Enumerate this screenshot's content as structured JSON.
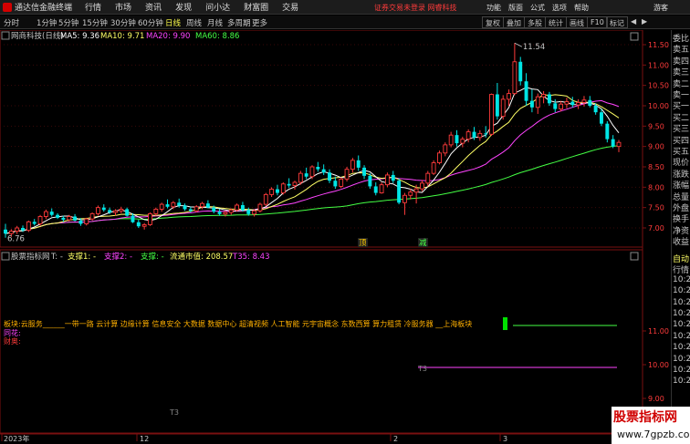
{
  "menubar": {
    "app_title": "通达信金融终端",
    "menus": [
      "行情",
      "市场",
      "资讯",
      "发现",
      "问小达",
      "财富圈",
      "交易"
    ],
    "status": "证券交易未登录  网睿科技",
    "right_menus": [
      "功能",
      "版面",
      "公式",
      "选项",
      "帮助",
      "游客"
    ]
  },
  "periodbar": {
    "periods": [
      "分时",
      "1分钟",
      "5分钟",
      "15分钟",
      "30分钟",
      "60分钟",
      "日线",
      "周线",
      "月线",
      "多周期",
      "更多"
    ],
    "active": "日线",
    "right_buttons": [
      "复权",
      "叠加",
      "多股",
      "统计",
      "画线",
      "F10",
      "标记"
    ]
  },
  "main_chart": {
    "stock_name": "网商科技(日线)",
    "ma_legend": [
      {
        "label": "MA5: 9.36",
        "color": "#ffffff"
      },
      {
        "label": "MA10: 9.71",
        "color": "#ffff66"
      },
      {
        "label": "MA20: 9.90",
        "color": "#ff44ff"
      },
      {
        "label": "MA60: 8.86",
        "color": "#44ff44"
      }
    ],
    "high_label": "11.54",
    "low_label": "6.76",
    "markers": [
      {
        "text": "顶",
        "color": "#ffcc00"
      },
      {
        "text": "减",
        "color": "#44ff44"
      }
    ]
  },
  "indicator_panel": {
    "title": "股票指标网",
    "legend": [
      {
        "label": "T: -",
        "color": "#c8c8c8"
      },
      {
        "label": "支撑1: -",
        "color": "#ffff66"
      },
      {
        "label": "支撑2: -",
        "color": "#ff44ff"
      },
      {
        "label": "支撑: -",
        "color": "#44ff44"
      },
      {
        "label": "流通市值: 208.57",
        "color": "#ffff66"
      },
      {
        "label": "T35: 8.43",
        "color": "#ff44ff"
      }
    ],
    "sector_text": "板块:云服务______一带一路 云计算 边缘计算 信息安全 大数据 数据中心 超清视频 人工智能 元宇宙概念 东数西算 算力租赁 冷服务器 __上海板块",
    "line2": "同花:",
    "line3": "财奥:",
    "t3_label": "T3",
    "t3_label2": "T3"
  },
  "xaxis": {
    "labels": [
      "2023年",
      "12",
      "2",
      "3"
    ]
  },
  "right_panel": {
    "top_items": [
      {
        "t": "委比",
        "c": "#c8c8c8"
      },
      {
        "t": "卖五",
        "c": "#c8c8c8"
      },
      {
        "t": "卖四",
        "c": "#c8c8c8"
      },
      {
        "t": "卖三",
        "c": "#c8c8c8"
      },
      {
        "t": "卖二",
        "c": "#c8c8c8"
      },
      {
        "t": "卖一",
        "c": "#c8c8c8"
      },
      {
        "t": "买一",
        "c": "#c8c8c8"
      },
      {
        "t": "买二",
        "c": "#c8c8c8"
      },
      {
        "t": "买三",
        "c": "#c8c8c8"
      },
      {
        "t": "买四",
        "c": "#c8c8c8"
      },
      {
        "t": "买五",
        "c": "#c8c8c8"
      },
      {
        "t": "现价",
        "c": "#c8c8c8"
      },
      {
        "t": "涨跌",
        "c": "#c8c8c8"
      },
      {
        "t": "涨幅",
        "c": "#c8c8c8"
      },
      {
        "t": "总量",
        "c": "#c8c8c8"
      },
      {
        "t": "外盘",
        "c": "#c8c8c8"
      },
      {
        "t": "换手",
        "c": "#c8c8c8"
      },
      {
        "t": "净资",
        "c": "#c8c8c8"
      },
      {
        "t": "收益",
        "c": "#c8c8c8"
      }
    ],
    "bottom_items": [
      {
        "t": "自动",
        "c": "#ffff66"
      },
      {
        "t": "行情",
        "c": "#c8c8c8"
      },
      {
        "t": "10:27",
        "c": "#c8c8c8"
      },
      {
        "t": "10:27",
        "c": "#c8c8c8"
      },
      {
        "t": "10:27",
        "c": "#c8c8c8"
      },
      {
        "t": "10:27",
        "c": "#c8c8c8"
      },
      {
        "t": "10:27",
        "c": "#c8c8c8"
      },
      {
        "t": "10:27",
        "c": "#c8c8c8"
      },
      {
        "t": "10:27",
        "c": "#c8c8c8"
      },
      {
        "t": "10:27",
        "c": "#c8c8c8"
      },
      {
        "t": "10:27",
        "c": "#c8c8c8"
      },
      {
        "t": "10:27",
        "c": "#c8c8c8"
      }
    ]
  },
  "watermark": {
    "line1": "股票指标网",
    "line2": "www.7gpzb.com"
  },
  "colors": {
    "up": "#ff3b3b",
    "down": "#00e5e5",
    "grid": "#7a1010"
  },
  "chart_data": {
    "type": "candlestick",
    "price_axis": {
      "min": 6.5,
      "max": 11.5,
      "ticks": [
        7.0,
        7.5,
        8.0,
        8.5,
        9.0,
        9.5,
        10.0,
        10.5,
        11.0,
        11.5
      ]
    },
    "indicator_axis": {
      "ticks": [
        8.0,
        9.0,
        10.0,
        11.0
      ]
    },
    "ohlc": [
      [
        6.96,
        7.1,
        6.76,
        6.86
      ],
      [
        6.86,
        6.97,
        6.78,
        6.92
      ],
      [
        6.92,
        7.05,
        6.85,
        7.0
      ],
      [
        7.0,
        7.06,
        6.9,
        6.94
      ],
      [
        6.94,
        7.18,
        6.9,
        7.15
      ],
      [
        7.15,
        7.22,
        7.06,
        7.1
      ],
      [
        7.1,
        7.32,
        7.05,
        7.28
      ],
      [
        7.28,
        7.45,
        7.22,
        7.4
      ],
      [
        7.4,
        7.48,
        7.28,
        7.32
      ],
      [
        7.32,
        7.36,
        7.22,
        7.25
      ],
      [
        7.25,
        7.3,
        7.15,
        7.2
      ],
      [
        7.2,
        7.32,
        7.16,
        7.28
      ],
      [
        7.28,
        7.34,
        7.16,
        7.18
      ],
      [
        7.18,
        7.24,
        7.05,
        7.1
      ],
      [
        7.1,
        7.25,
        7.06,
        7.22
      ],
      [
        7.22,
        7.38,
        7.18,
        7.35
      ],
      [
        7.35,
        7.55,
        7.3,
        7.5
      ],
      [
        7.5,
        7.58,
        7.4,
        7.44
      ],
      [
        7.44,
        7.5,
        7.34,
        7.38
      ],
      [
        7.38,
        7.46,
        7.3,
        7.42
      ],
      [
        7.42,
        7.52,
        7.36,
        7.46
      ],
      [
        7.46,
        7.5,
        7.28,
        7.3
      ],
      [
        7.3,
        7.36,
        7.12,
        7.14
      ],
      [
        7.14,
        7.2,
        7.0,
        7.04
      ],
      [
        7.04,
        7.12,
        6.96,
        7.08
      ],
      [
        7.08,
        7.38,
        7.05,
        7.35
      ],
      [
        7.35,
        7.5,
        7.3,
        7.46
      ],
      [
        7.46,
        7.62,
        7.4,
        7.58
      ],
      [
        7.58,
        7.7,
        7.48,
        7.52
      ],
      [
        7.52,
        7.66,
        7.46,
        7.62
      ],
      [
        7.62,
        7.72,
        7.5,
        7.55
      ],
      [
        7.55,
        7.6,
        7.42,
        7.46
      ],
      [
        7.46,
        7.52,
        7.38,
        7.42
      ],
      [
        7.42,
        7.56,
        7.38,
        7.52
      ],
      [
        7.52,
        7.64,
        7.46,
        7.6
      ],
      [
        7.6,
        7.68,
        7.48,
        7.5
      ],
      [
        7.5,
        7.55,
        7.36,
        7.4
      ],
      [
        7.4,
        7.46,
        7.3,
        7.34
      ],
      [
        7.34,
        7.42,
        7.28,
        7.38
      ],
      [
        7.38,
        7.48,
        7.32,
        7.44
      ],
      [
        7.44,
        7.6,
        7.4,
        7.56
      ],
      [
        7.56,
        7.64,
        7.4,
        7.44
      ],
      [
        7.44,
        7.5,
        7.3,
        7.34
      ],
      [
        7.34,
        7.46,
        7.28,
        7.42
      ],
      [
        7.42,
        7.62,
        7.38,
        7.58
      ],
      [
        7.58,
        7.86,
        7.54,
        7.82
      ],
      [
        7.82,
        8.0,
        7.76,
        7.95
      ],
      [
        7.95,
        8.06,
        7.8,
        7.86
      ],
      [
        7.86,
        8.12,
        7.82,
        8.08
      ],
      [
        8.08,
        8.22,
        7.98,
        8.04
      ],
      [
        8.04,
        8.16,
        7.94,
        8.12
      ],
      [
        8.12,
        8.4,
        8.06,
        8.34
      ],
      [
        8.34,
        8.48,
        8.2,
        8.26
      ],
      [
        8.26,
        8.54,
        8.2,
        8.5
      ],
      [
        8.5,
        8.62,
        8.38,
        8.44
      ],
      [
        8.44,
        8.56,
        8.3,
        8.36
      ],
      [
        8.36,
        8.44,
        8.1,
        8.16
      ],
      [
        8.16,
        8.26,
        7.96,
        8.02
      ],
      [
        8.02,
        8.24,
        7.98,
        8.2
      ],
      [
        8.2,
        8.5,
        8.14,
        8.44
      ],
      [
        8.44,
        8.72,
        8.36,
        8.66
      ],
      [
        8.66,
        8.78,
        8.4,
        8.48
      ],
      [
        8.48,
        8.54,
        8.2,
        8.28
      ],
      [
        8.28,
        8.34,
        7.96,
        8.02
      ],
      [
        8.02,
        8.12,
        7.8,
        7.86
      ],
      [
        7.86,
        8.12,
        7.84,
        8.06
      ],
      [
        8.06,
        8.36,
        8.0,
        8.3
      ],
      [
        8.3,
        8.4,
        8.1,
        8.16
      ],
      [
        8.16,
        8.22,
        7.58,
        7.62
      ],
      [
        7.62,
        7.86,
        7.32,
        7.8
      ],
      [
        7.8,
        7.96,
        7.7,
        7.88
      ],
      [
        7.88,
        8.06,
        7.6,
        7.96
      ],
      [
        7.96,
        8.18,
        7.9,
        8.1
      ],
      [
        8.1,
        8.4,
        8.02,
        8.34
      ],
      [
        8.34,
        8.66,
        8.3,
        8.6
      ],
      [
        8.6,
        8.9,
        8.56,
        8.84
      ],
      [
        8.84,
        9.1,
        8.76,
        9.04
      ],
      [
        9.04,
        9.36,
        8.98,
        9.28
      ],
      [
        9.28,
        9.4,
        9.0,
        9.08
      ],
      [
        9.08,
        9.24,
        8.98,
        9.18
      ],
      [
        9.18,
        9.42,
        9.1,
        9.36
      ],
      [
        9.36,
        9.48,
        9.16,
        9.22
      ],
      [
        9.22,
        9.4,
        9.14,
        9.32
      ],
      [
        9.32,
        9.5,
        9.22,
        9.3
      ],
      [
        9.3,
        10.3,
        9.26,
        10.28
      ],
      [
        10.28,
        10.56,
        9.66,
        9.74
      ],
      [
        9.74,
        10.26,
        9.66,
        10.16
      ],
      [
        10.16,
        10.4,
        10.0,
        10.3
      ],
      [
        10.3,
        11.54,
        10.26,
        11.08
      ],
      [
        11.08,
        11.2,
        10.5,
        10.6
      ],
      [
        10.6,
        10.8,
        10.0,
        10.12
      ],
      [
        10.12,
        10.4,
        9.84,
        9.96
      ],
      [
        9.96,
        10.3,
        9.8,
        10.22
      ],
      [
        10.22,
        10.36,
        10.06,
        10.28
      ],
      [
        10.28,
        10.34,
        10.0,
        10.06
      ],
      [
        10.06,
        10.16,
        9.84,
        9.92
      ],
      [
        9.92,
        10.12,
        9.86,
        10.04
      ],
      [
        10.04,
        10.2,
        9.94,
        10.1
      ],
      [
        10.1,
        10.22,
        9.96,
        10.02
      ],
      [
        10.02,
        10.16,
        9.92,
        10.08
      ],
      [
        10.08,
        10.24,
        9.98,
        10.14
      ],
      [
        10.14,
        10.24,
        9.96,
        10.0
      ],
      [
        10.0,
        10.06,
        9.78,
        9.84
      ],
      [
        9.84,
        9.92,
        9.5,
        9.56
      ],
      [
        9.56,
        9.62,
        9.1,
        9.18
      ],
      [
        9.18,
        9.28,
        8.96,
        9.0
      ],
      [
        9.0,
        9.16,
        8.86,
        9.1
      ]
    ]
  }
}
